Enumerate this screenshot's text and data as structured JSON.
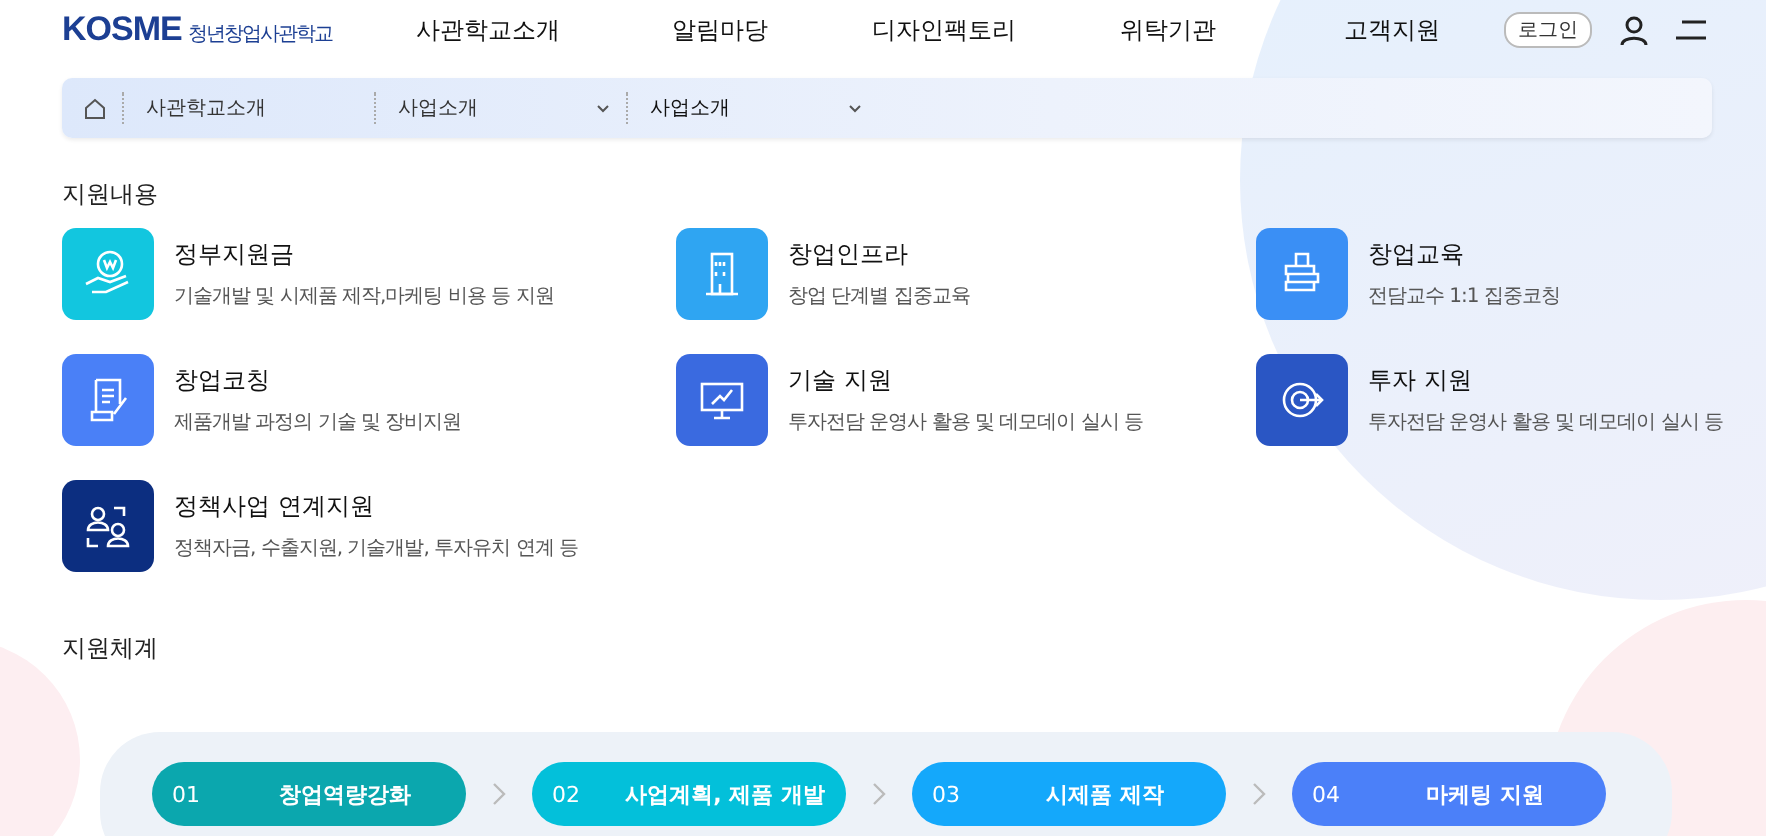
{
  "header": {
    "logo": "KOSME",
    "logo_subtitle": "청년창업사관학교",
    "nav": [
      "사관학교소개",
      "알림마당",
      "디자인팩토리",
      "위탁기관",
      "고객지원"
    ],
    "login": "로그인"
  },
  "breadcrumb": [
    {
      "label": "사관학교소개",
      "dropdown": false
    },
    {
      "label": "사업소개",
      "dropdown": true
    },
    {
      "label": "사업소개",
      "dropdown": true
    }
  ],
  "support": {
    "title": "지원내용",
    "items": [
      {
        "kind": "money",
        "title": "정부지원금",
        "desc": "기술개발 및 시제품 제작,마케팅 비용 등 지원",
        "color": "#12c6df"
      },
      {
        "kind": "building",
        "title": "창업인프라",
        "desc": "창업 단계별 집중교육",
        "color": "#2fa5f2"
      },
      {
        "kind": "books",
        "title": "창업교육",
        "desc": "전담교수 1:1 집중코칭",
        "color": "#3a8ff5"
      },
      {
        "kind": "document",
        "title": "창업코칭",
        "desc": "제품개발 과정의 기술 및 장비지원",
        "color": "#4a80f7"
      },
      {
        "kind": "monitor",
        "title": "기술 지원",
        "desc": "투자전담 운영사 활용 및 데모데이 실시 등",
        "color": "#3a6ae0"
      },
      {
        "kind": "target",
        "title": "투자 지원",
        "desc": "투자전담 운영사 활용  및 데모데이 실시 등",
        "color": "#2a56c4"
      },
      {
        "kind": "people",
        "title": "정책사업 연계지원",
        "desc": "정책자금, 수출지원, 기술개발, 투자유치 연계 등",
        "color": "#0c2e80"
      }
    ]
  },
  "system": {
    "title": "지원체계",
    "steps": [
      {
        "number": "01",
        "label": "창업역량강화",
        "color": "#0ba7ae"
      },
      {
        "number": "02",
        "label": "사업계획, 제품 개발",
        "color": "#03c0da"
      },
      {
        "number": "03",
        "label": "시제품 제작",
        "color": "#14a8fb"
      },
      {
        "number": "04",
        "label": "마케팅 지원",
        "color": "#4b80f9"
      }
    ]
  }
}
